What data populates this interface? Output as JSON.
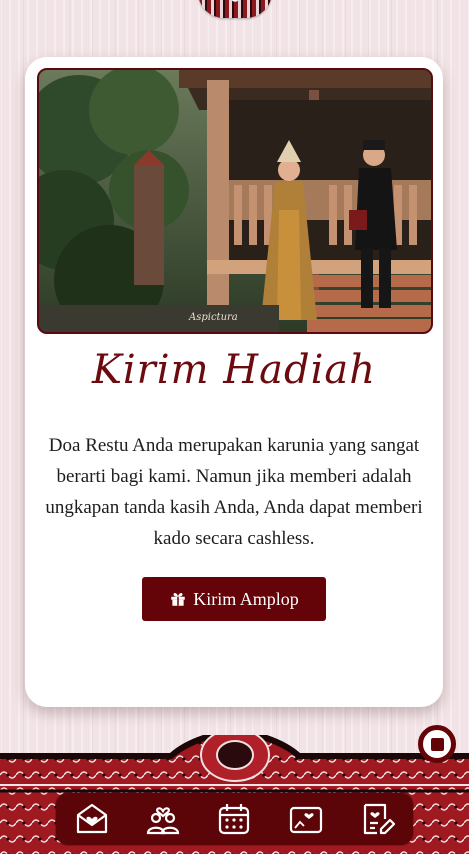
{
  "section": {
    "title": "Kirim Hadiah",
    "description": "Doa Restu Anda merupakan karunia yang sangat berarti bagi kami. Namun jika memberi adalah ungkapan tanda kasih Anda, Anda dapat memberi kado secara cashless.",
    "button_label": "Kirim Amplop",
    "button_icon": "gift-icon"
  },
  "photo": {
    "watermark": "Aspictura"
  },
  "nav": {
    "items": [
      {
        "icon": "envelope-heart-icon"
      },
      {
        "icon": "couple-icon"
      },
      {
        "icon": "calendar-icon"
      },
      {
        "icon": "photo-frame-heart-icon"
      },
      {
        "icon": "guestbook-edit-icon"
      }
    ]
  },
  "music": {
    "icon": "stop-icon"
  },
  "colors": {
    "primary": "#640308",
    "title": "#6b0b10",
    "background": "#f2e4e6"
  }
}
